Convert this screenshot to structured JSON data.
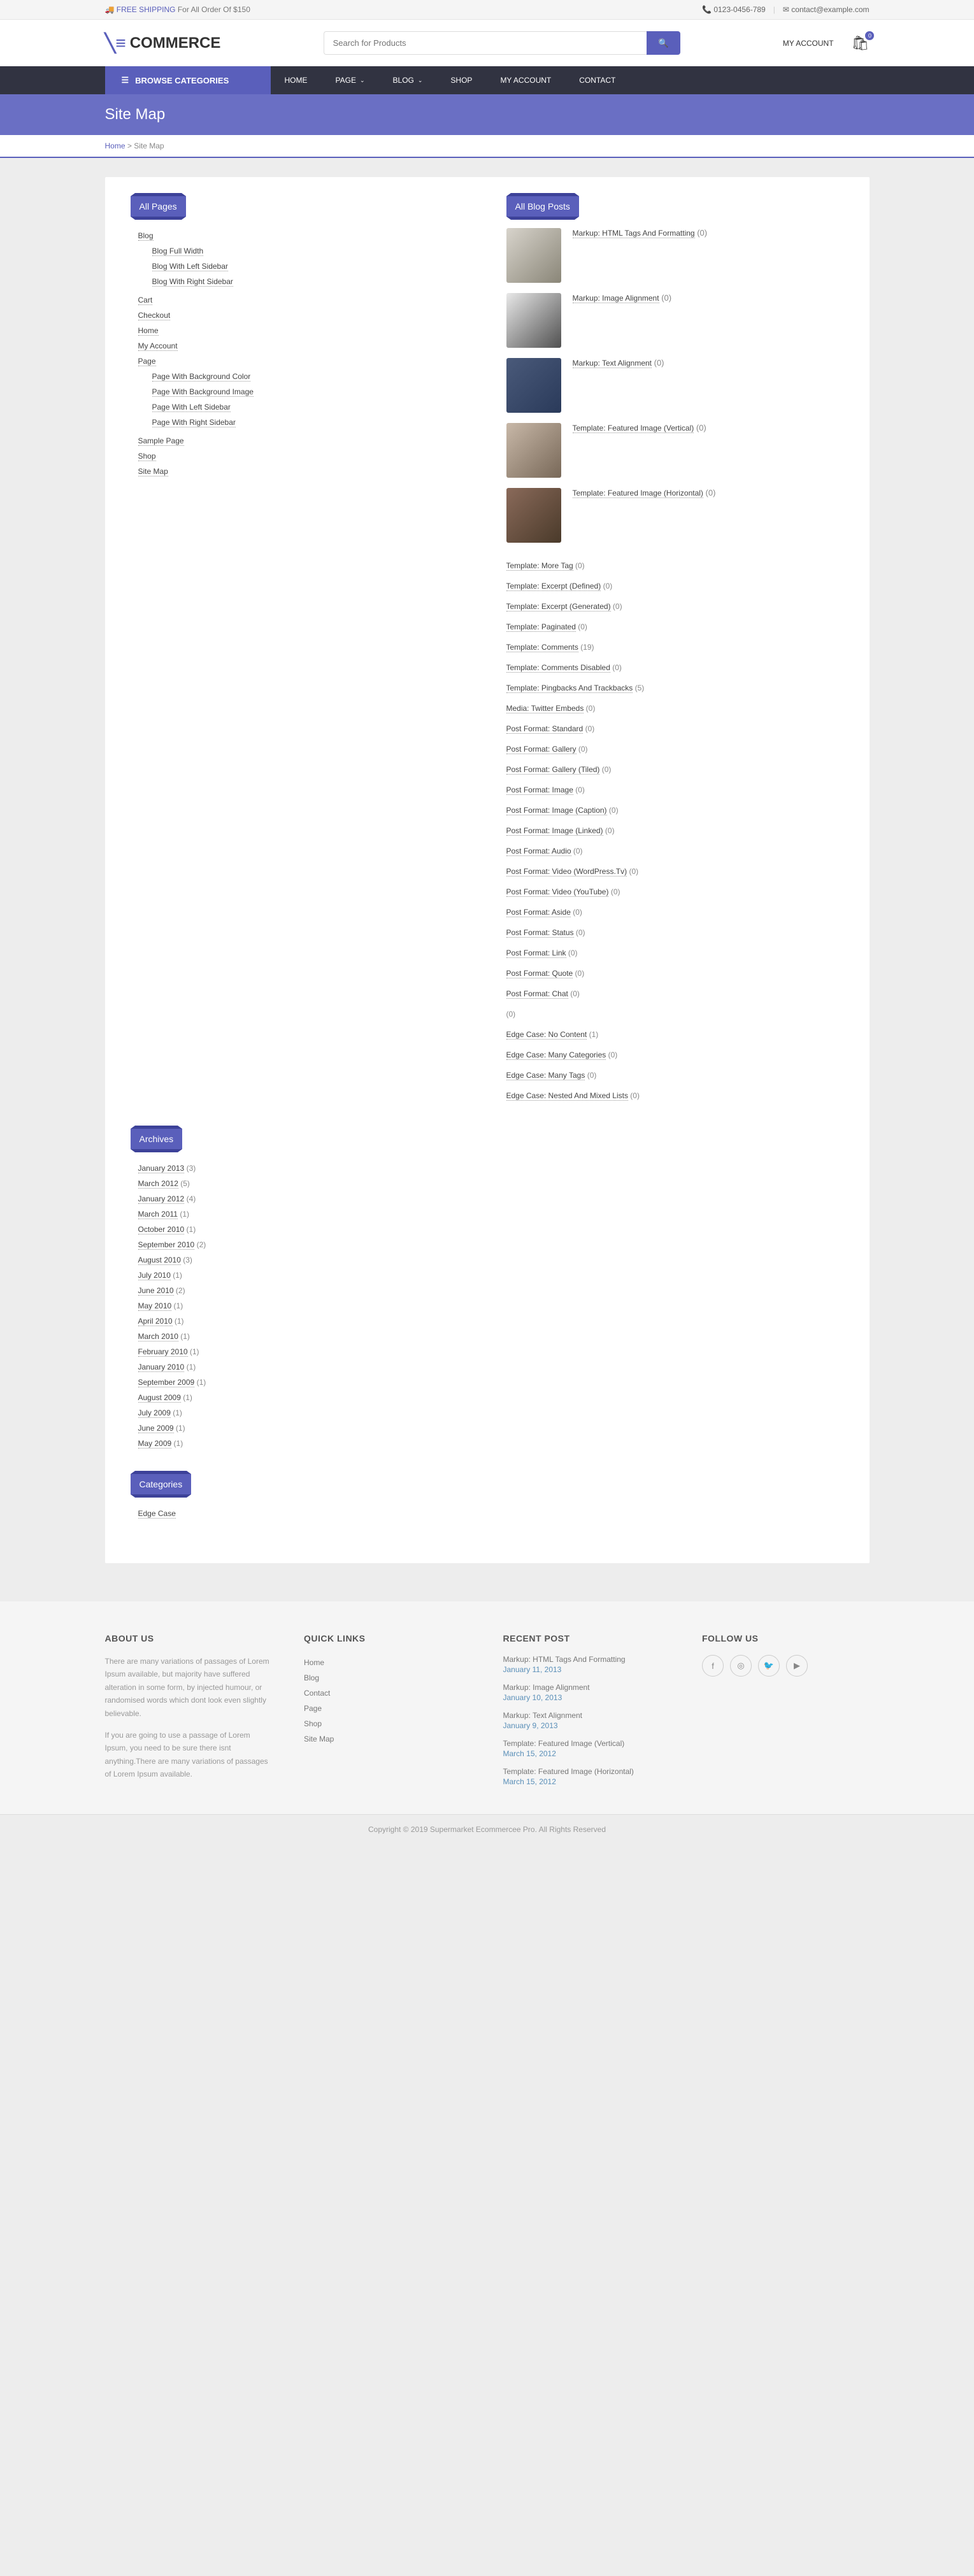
{
  "topbar": {
    "shipping_label": "FREE SHIPPING",
    "shipping_sub": "For All Order Of $150",
    "phone": "0123-0456-789",
    "email": "contact@example.com"
  },
  "header": {
    "logo": "COMMERCE",
    "search_placeholder": "Search for Products",
    "account": "MY ACCOUNT",
    "cart_count": "0"
  },
  "nav": {
    "browse": "BROWSE CATEGORIES",
    "items": [
      "HOME",
      "PAGE",
      "BLOG",
      "SHOP",
      "MY ACCOUNT",
      "CONTACT"
    ]
  },
  "page": {
    "title": "Site Map",
    "breadcrumb_home": "Home",
    "breadcrumb_current": "Site Map"
  },
  "sections": {
    "all_pages": "All Pages",
    "all_posts": "All Blog Posts",
    "archives": "Archives",
    "categories": "Categories"
  },
  "pages_tree": [
    {
      "label": "Blog",
      "children": [
        {
          "label": "Blog Full Width"
        },
        {
          "label": "Blog With Left Sidebar"
        },
        {
          "label": "Blog With Right Sidebar"
        }
      ]
    },
    {
      "label": "Cart"
    },
    {
      "label": "Checkout"
    },
    {
      "label": "Home"
    },
    {
      "label": "My Account"
    },
    {
      "label": "Page",
      "children": [
        {
          "label": "Page With Background Color"
        },
        {
          "label": "Page With Background Image"
        },
        {
          "label": "Page With Left Sidebar"
        },
        {
          "label": "Page With Right Sidebar"
        }
      ]
    },
    {
      "label": "Sample Page"
    },
    {
      "label": "Shop"
    },
    {
      "label": "Site Map"
    }
  ],
  "posts_thumbed": [
    {
      "title": "Markup: HTML Tags And Formatting",
      "count": "(0)"
    },
    {
      "title": "Markup: Image Alignment",
      "count": "(0)"
    },
    {
      "title": "Markup: Text Alignment",
      "count": "(0)"
    },
    {
      "title": "Template: Featured Image (Vertical)",
      "count": "(0)"
    },
    {
      "title": "Template: Featured Image (Horizontal)",
      "count": "(0)"
    }
  ],
  "posts_rest": [
    {
      "title": "Template: More Tag",
      "count": "(0)"
    },
    {
      "title": "Template: Excerpt (Defined)",
      "count": "(0)"
    },
    {
      "title": "Template: Excerpt (Generated)",
      "count": "(0)"
    },
    {
      "title": "Template: Paginated",
      "count": "(0)"
    },
    {
      "title": "Template: Comments",
      "count": "(19)"
    },
    {
      "title": "Template: Comments Disabled",
      "count": "(0)"
    },
    {
      "title": "Template: Pingbacks And Trackbacks",
      "count": "(5)"
    },
    {
      "title": "Media: Twitter Embeds",
      "count": "(0)"
    },
    {
      "title": "Post Format: Standard",
      "count": "(0)"
    },
    {
      "title": "Post Format: Gallery",
      "count": "(0)"
    },
    {
      "title": "Post Format: Gallery (Tiled)",
      "count": "(0)"
    },
    {
      "title": "Post Format: Image",
      "count": "(0)"
    },
    {
      "title": "Post Format: Image (Caption)",
      "count": "(0)"
    },
    {
      "title": "Post Format: Image (Linked)",
      "count": "(0)"
    },
    {
      "title": "Post Format: Audio",
      "count": "(0)"
    },
    {
      "title": "Post Format: Video (WordPress.Tv)",
      "count": "(0)"
    },
    {
      "title": "Post Format: Video (YouTube)",
      "count": "(0)"
    },
    {
      "title": "Post Format: Aside",
      "count": "(0)"
    },
    {
      "title": "Post Format: Status",
      "count": "(0)"
    },
    {
      "title": "Post Format: Link",
      "count": "(0)"
    },
    {
      "title": "Post Format: Quote",
      "count": "(0)"
    },
    {
      "title": "Post Format: Chat",
      "count": "(0)"
    },
    {
      "title": "",
      "count": "(0)"
    },
    {
      "title": "Edge Case: No Content",
      "count": "(1)"
    },
    {
      "title": "Edge Case: Many Categories",
      "count": "(0)"
    },
    {
      "title": "Edge Case: Many Tags",
      "count": "(0)"
    },
    {
      "title": "Edge Case: Nested And Mixed Lists",
      "count": "(0)"
    }
  ],
  "archives": [
    {
      "label": "January 2013",
      "count": "(3)"
    },
    {
      "label": "March 2012",
      "count": "(5)"
    },
    {
      "label": "January 2012",
      "count": "(4)"
    },
    {
      "label": "March 2011",
      "count": "(1)"
    },
    {
      "label": "October 2010",
      "count": "(1)"
    },
    {
      "label": "September 2010",
      "count": "(2)"
    },
    {
      "label": "August 2010",
      "count": "(3)"
    },
    {
      "label": "July 2010",
      "count": "(1)"
    },
    {
      "label": "June 2010",
      "count": "(2)"
    },
    {
      "label": "May 2010",
      "count": "(1)"
    },
    {
      "label": "April 2010",
      "count": "(1)"
    },
    {
      "label": "March 2010",
      "count": "(1)"
    },
    {
      "label": "February 2010",
      "count": "(1)"
    },
    {
      "label": "January 2010",
      "count": "(1)"
    },
    {
      "label": "September 2009",
      "count": "(1)"
    },
    {
      "label": "August 2009",
      "count": "(1)"
    },
    {
      "label": "July 2009",
      "count": "(1)"
    },
    {
      "label": "June 2009",
      "count": "(1)"
    },
    {
      "label": "May 2009",
      "count": "(1)"
    }
  ],
  "categories": [
    {
      "label": "Edge Case"
    }
  ],
  "footer": {
    "about_title": "ABOUT US",
    "about_p1": "There are many variations of passages of Lorem Ipsum available, but majority have suffered alteration in some form, by injected humour, or randomised words which dont look even slightly believable.",
    "about_p2": "If you are going to use a passage of Lorem Ipsum, you need to be sure there isnt anything.There are many variations of passages of Lorem Ipsum available.",
    "quick_title": "QUICK LINKS",
    "quick_links": [
      "Home",
      "Blog",
      "Contact",
      "Page",
      "Shop",
      "Site Map"
    ],
    "recent_title": "RECENT POST",
    "recent": [
      {
        "title": "Markup: HTML Tags And Formatting",
        "date": "January 11, 2013"
      },
      {
        "title": "Markup: Image Alignment",
        "date": "January 10, 2013"
      },
      {
        "title": "Markup: Text Alignment",
        "date": "January 9, 2013"
      },
      {
        "title": "Template: Featured Image (Vertical)",
        "date": "March 15, 2012"
      },
      {
        "title": "Template: Featured Image (Horizontal)",
        "date": "March 15, 2012"
      }
    ],
    "follow_title": "FOLLOW US"
  },
  "copyright": "Copyright © 2019 Supermarket Ecommercee Pro. All Rights Reserved"
}
